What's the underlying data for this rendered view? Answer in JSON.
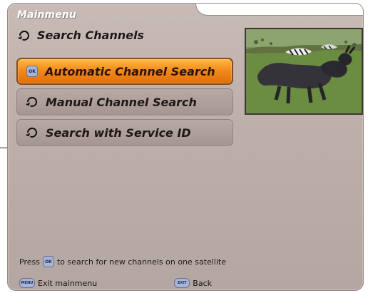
{
  "window": {
    "title": "Mainmenu"
  },
  "submenu": {
    "label": "Search Channels",
    "icon": "circle-arrow-icon"
  },
  "menu": {
    "items": [
      {
        "label": "Automatic Channel Search",
        "selected": true,
        "icon": "ok-icon"
      },
      {
        "label": "Manual Channel Search",
        "selected": false,
        "icon": "circle-arrow-icon"
      },
      {
        "label": "Search with Service ID",
        "selected": false,
        "icon": "circle-arrow-icon"
      }
    ]
  },
  "footer": {
    "hint_prefix": "Press",
    "hint_button": "OK",
    "hint_suffix": "to search for new channels on one satellite",
    "exit_button": "MENU",
    "exit_label": "Exit mainmenu",
    "back_button": "EXIT",
    "back_label": "Back"
  },
  "colors": {
    "panel": "#c2b4ae",
    "selected_start": "#ffbb44",
    "selected_end": "#e06f0a",
    "text": "#1b1717"
  }
}
